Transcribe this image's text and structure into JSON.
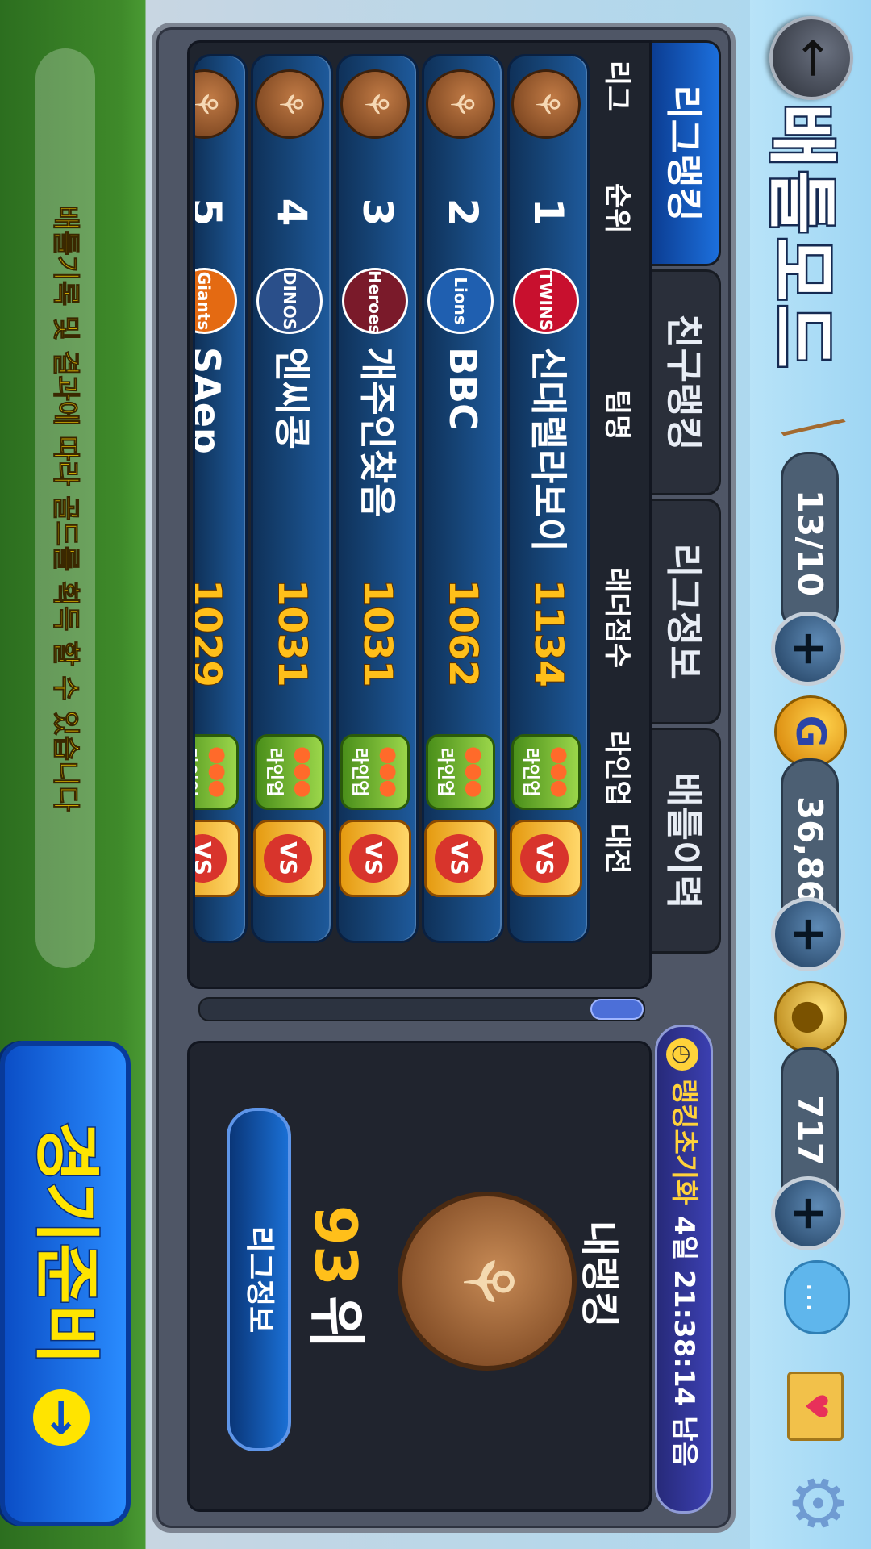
{
  "header": {
    "title": "배틀모드",
    "bats": "13/10",
    "gold": "36,865",
    "balls": "717"
  },
  "tabs": [
    {
      "label": "리그랭킹",
      "active": true
    },
    {
      "label": "친구랭킹",
      "active": false
    },
    {
      "label": "리그정보",
      "active": false
    },
    {
      "label": "배틀이력",
      "active": false
    }
  ],
  "timer": {
    "label": "랭킹초기화",
    "value": "4일 21:38:14 남음"
  },
  "list": {
    "headers": {
      "league": "리그",
      "rank": "순위",
      "team": "팀명",
      "score": "래더점수",
      "lineup": "라인업",
      "battle": "대전"
    },
    "rows": [
      {
        "rank": "1",
        "team": "신대렐라보이",
        "logo": "TWINS",
        "logo_color": "#c8102e",
        "score": "1134"
      },
      {
        "rank": "2",
        "team": "BBC",
        "logo": "Lions",
        "logo_color": "#1f5fb0",
        "score": "1062"
      },
      {
        "rank": "3",
        "team": "개주인찾음",
        "logo": "Heroes",
        "logo_color": "#7a1a2a",
        "score": "1031"
      },
      {
        "rank": "4",
        "team": "엔씨콩",
        "logo": "DINOS",
        "logo_color": "#2a4f8a",
        "score": "1031"
      },
      {
        "rank": "5",
        "team": "SAep",
        "logo": "Giants",
        "logo_color": "#e46a12",
        "score": "1029"
      }
    ],
    "lineup_label": "라인업",
    "vs_label": "VS"
  },
  "my_ranking": {
    "title": "내랭킹",
    "rank": "93",
    "unit": "위",
    "button": "리그정보"
  },
  "notice": "배틀기록 및 결과에 따라 골드를 획득 할 수 있습니다",
  "start_button": "경기준비",
  "colors": {
    "accent_blue": "#1c6fdc",
    "score_yellow": "#ffbf1a",
    "notice_yellow": "#ffd400"
  }
}
